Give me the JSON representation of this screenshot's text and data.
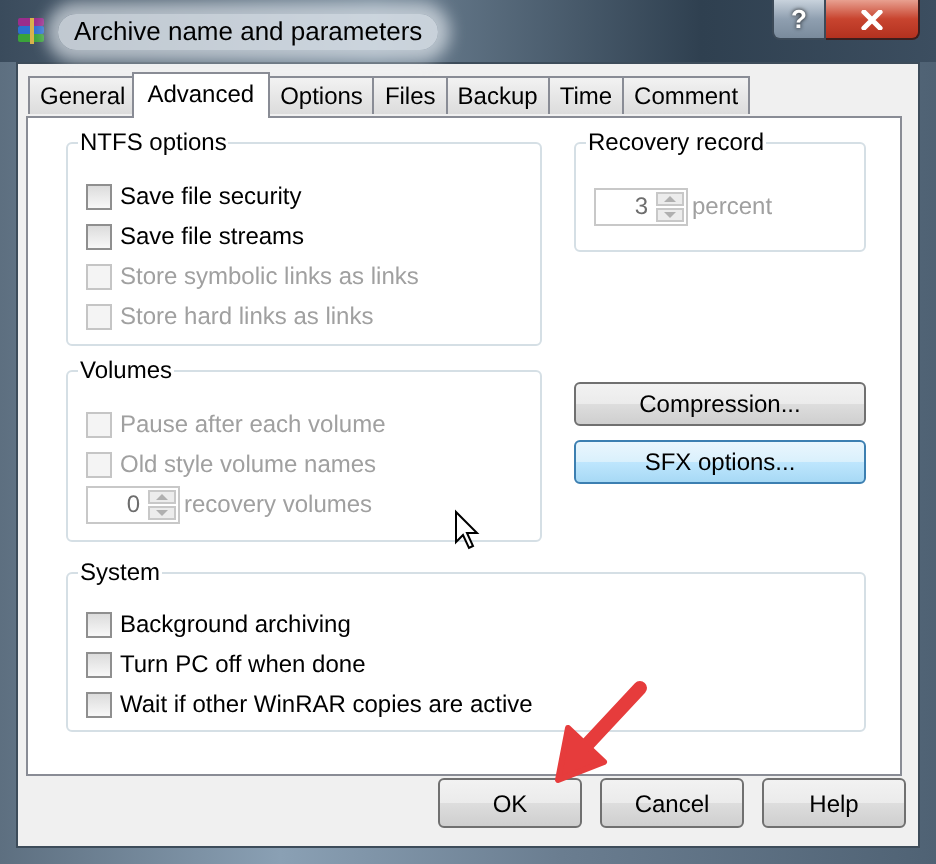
{
  "window": {
    "title": "Archive name and parameters",
    "help_button": "?"
  },
  "tabs": [
    {
      "label": "General",
      "selected": false
    },
    {
      "label": "Advanced",
      "selected": true
    },
    {
      "label": "Options",
      "selected": false
    },
    {
      "label": "Files",
      "selected": false
    },
    {
      "label": "Backup",
      "selected": false
    },
    {
      "label": "Time",
      "selected": false
    },
    {
      "label": "Comment",
      "selected": false
    }
  ],
  "ntfs_options": {
    "title": "NTFS options",
    "options": [
      {
        "label": "Save file security",
        "checked": false,
        "disabled": false
      },
      {
        "label": "Save file streams",
        "checked": false,
        "disabled": false
      },
      {
        "label": "Store symbolic links as links",
        "checked": false,
        "disabled": true
      },
      {
        "label": "Store hard links as links",
        "checked": false,
        "disabled": true
      }
    ]
  },
  "recovery_record": {
    "title": "Recovery record",
    "value": "3",
    "unit": "percent",
    "disabled": true
  },
  "volumes": {
    "title": "Volumes",
    "options": [
      {
        "label": "Pause after each volume",
        "checked": false,
        "disabled": true
      },
      {
        "label": "Old style volume names",
        "checked": false,
        "disabled": true
      }
    ],
    "recovery_volumes": {
      "value": "0",
      "unit": "recovery volumes",
      "disabled": true
    }
  },
  "side_buttons": [
    {
      "label": "Compression...",
      "hovered": false
    },
    {
      "label": "SFX options...",
      "hovered": true
    }
  ],
  "system": {
    "title": "System",
    "options": [
      {
        "label": "Background archiving",
        "checked": false,
        "disabled": false
      },
      {
        "label": "Turn PC off when done",
        "checked": false,
        "disabled": false
      },
      {
        "label": "Wait if other WinRAR copies are active",
        "checked": false,
        "disabled": false
      }
    ]
  },
  "buttons": [
    {
      "label": "OK"
    },
    {
      "label": "Cancel"
    },
    {
      "label": "Help"
    }
  ]
}
